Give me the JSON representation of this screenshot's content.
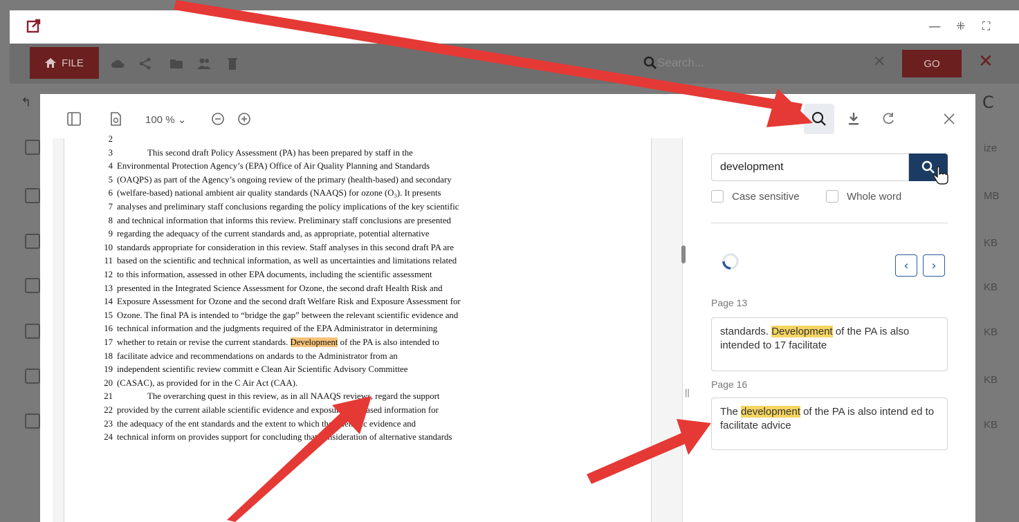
{
  "outer": {
    "file_label": "FILE",
    "search_placeholder": "Search...",
    "go_label": "GO",
    "sizes": [
      "ize",
      "MB",
      "KB",
      "KB",
      "KB",
      "KB",
      "KB"
    ]
  },
  "viewer": {
    "zoom": "100 %",
    "lines": [
      {
        "n": "2",
        "t": "",
        "indent": false
      },
      {
        "n": "3",
        "t": "This second draft Policy Assessment (PA) has been prepared by staff in the",
        "indent": true
      },
      {
        "n": "4",
        "t": "Environmental Protection Agency’s (EPA) Office of Air Quality Planning and Standards",
        "indent": false
      },
      {
        "n": "5",
        "t": "(OAQPS) as part of the Agency’s ongoing review of the primary (health-based) and secondary",
        "indent": false
      },
      {
        "n": "6",
        "t": "(welfare-based) national ambient air quality standards (NAAQS) for ozone (O₃).  It presents",
        "indent": false
      },
      {
        "n": "7",
        "t": "analyses and preliminary staff conclusions regarding the policy implications of the key scientific",
        "indent": false
      },
      {
        "n": "8",
        "t": "and technical information that informs this review.   Preliminary staff conclusions are presented",
        "indent": false
      },
      {
        "n": "9",
        "t": "regarding the adequacy of the current standards and, as appropriate, potential alternative",
        "indent": false
      },
      {
        "n": "10",
        "t": "standards appropriate for consideration in this review.  Staff analyses in this second draft PA are",
        "indent": false
      },
      {
        "n": "11",
        "t": "based on the scientific and technical information, as well as uncertainties and limitations related",
        "indent": false
      },
      {
        "n": "12",
        "t": "to this information, assessed in other EPA documents, including the scientific assessment",
        "indent": false
      },
      {
        "n": "13",
        "t": "presented in the Integrated Science Assessment for Ozone, the second draft Health Risk and",
        "indent": false
      },
      {
        "n": "14",
        "t": "Exposure Assessment for Ozone and the second draft Welfare Risk and Exposure Assessment for",
        "indent": false
      },
      {
        "n": "15",
        "t": "Ozone.  The final PA is intended to “bridge the gap” between the relevant scientific evidence and",
        "indent": false
      },
      {
        "n": "16",
        "t": "technical information and the judgments required of the EPA Administrator in determining",
        "indent": false
      },
      {
        "n": "17",
        "t": "",
        "indent": false
      },
      {
        "n": "18",
        "t": "facilitate advice and recommendations on    andards to the Administrator from an",
        "indent": false
      },
      {
        "n": "19",
        "t": "independent scientific review committ     e Clean Air Scientific Advisory Committee",
        "indent": false
      },
      {
        "n": "20",
        "t": "(CASAC), as provided for in the C     Air Act (CAA).",
        "indent": false
      },
      {
        "n": "21",
        "t": "The overarching quest     in this review, as in all NAAQS reviews, regard the support",
        "indent": true
      },
      {
        "n": "22",
        "t": "provided by the current     ailable scientific evidence and exposure/risk-based information for",
        "indent": false
      },
      {
        "n": "23",
        "t": "the adequacy of the      ent standards and the extent to which the scientific evidence and",
        "indent": false
      },
      {
        "n": "24",
        "t": "technical inform     on provides support for concluding that consideration of alternative standards",
        "indent": false
      }
    ],
    "line17_before": "whether to retain or revise the current standards.  ",
    "line17_hit": "Development",
    "line17_after": " of the PA is also intended to"
  },
  "search": {
    "query": "development",
    "case_sensitive_label": "Case sensitive",
    "whole_word_label": "Whole word",
    "results": [
      {
        "page": "Page 13",
        "before": "standards. ",
        "hit": "Development",
        "after": " of the PA is also intended to 17 facilitate"
      },
      {
        "page": "Page 16",
        "before": "The ",
        "hit": "development",
        "after": " of the PA is also intend ed to facilitate advice"
      }
    ]
  },
  "colors": {
    "accent_dark_red": "#6b1f1f",
    "search_button": "#1c3b63",
    "highlight_yellow": "#f5d561",
    "highlight_orange": "#f7c27a",
    "arrow_red": "#e53935"
  }
}
